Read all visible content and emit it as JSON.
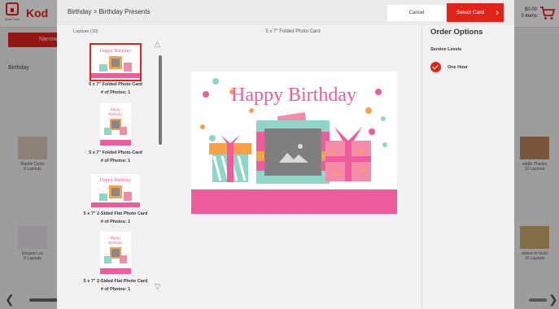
{
  "background": {
    "start_over": "Start Over",
    "logo": "Kod",
    "cart_price": "$0.00",
    "cart_items": "0 items",
    "narrow": "Narrow",
    "category": "Birthday",
    "tiles": [
      {
        "label": "Marble Quinc",
        "count": "8 Layouts"
      },
      {
        "label": "Elegant Lac",
        "count": "8 Layouts"
      },
      {
        "label": "etallic Thanks",
        "count": "10 Layouts"
      },
      {
        "label": "acious in Gold",
        "count": "10 Layouts"
      }
    ]
  },
  "modal": {
    "breadcrumb": "Birthday > Birthday Presents",
    "cancel_label": "Cancel",
    "select_label": "Select Card",
    "layouts_title": "Layouts (10)",
    "layouts": [
      {
        "name": "5 x 7\" Folded Photo Card",
        "photos": "# of Photos:  1"
      },
      {
        "name": "5 x 7\" Folded Photo Card",
        "photos": "# of Photos:  1"
      },
      {
        "name": "5 x 7\" 2-Sided Flat Photo Card",
        "photos": "# of Photos:  1"
      },
      {
        "name": "5 x 7\" 2-Sided Flat Photo Card",
        "photos": "# of Photos:  1"
      }
    ],
    "preview_title": "5 x 7\" Folded Photo Card",
    "card_text": "Happy Birthday",
    "order_options_title": "Order Options",
    "service_levels_label": "Service Levels",
    "service_option": "One Hour"
  },
  "colors": {
    "accent": "#e2231a",
    "pink": "#ef5c9c",
    "teal": "#8fd6c8",
    "orange": "#f7a24b"
  }
}
